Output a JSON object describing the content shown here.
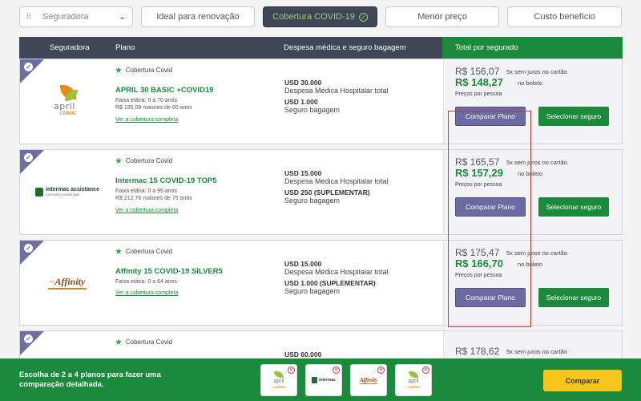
{
  "filters": {
    "insurer_select": {
      "placeholder": "Seguradora",
      "icon": "sliders-icon"
    },
    "buttons": [
      {
        "label": "Ideal para renovação",
        "active": false
      },
      {
        "label": "Cobertura COVID-19",
        "active": true
      },
      {
        "label": "Menor preço",
        "active": false
      },
      {
        "label": "Custo benefício",
        "active": false
      }
    ]
  },
  "table_header": {
    "insurer": "Seguradora",
    "plan": "Plano",
    "expenses": "Despesa médica e seguro bagagem",
    "total": "Total por segurado"
  },
  "plans": [
    {
      "insurer_logo": "April Corris",
      "logo_text": "april",
      "logo_subtext": "CORRIS",
      "covid_tag": "Cobertura Covid",
      "name": "APRIL 30 BASIC +COVID19",
      "faixa": "Faixa etária: 0 a 70 anos",
      "older_price": "R$ 195,09 maiores de 60 anos",
      "link": "Ver a cobertura completa",
      "medical_amount": "USD 30.000",
      "medical_label": "Despesa Médica Hospitalar total",
      "baggage_amount": "USD 1.000",
      "baggage_label": "Seguro bagagem",
      "price_card": "R$ 156,07",
      "price_card_note": "5x sem juros no cartão",
      "price_boleto": "R$ 148,27",
      "price_boleto_note": "no boleto",
      "price_note": "Preços por pessoa",
      "compare_label": "Comparar Plano",
      "select_label": "Selecionar seguro"
    },
    {
      "insurer_logo": "Intermac Assistance",
      "logo_text": "intermac assistance",
      "logo_subtext": "A SEGURO VIAGEM MAIS",
      "covid_tag": "Cobertura Covid",
      "name": "Intermac 15 COVID-19 TOP5",
      "faixa": "Faixa etária: 0 a 95 anos",
      "older_price": "R$ 212,76 maiores de 75 anos",
      "link": "Ver a cobertura completa",
      "medical_amount": "USD 15.000",
      "medical_label": "Despesa Médica Hospitalar total",
      "baggage_amount": "USD 250 (SUPLEMENTAR)",
      "baggage_label": "Seguro bagagem",
      "price_card": "R$ 165,57",
      "price_card_note": "5x sem juros no cartão",
      "price_boleto": "R$ 157,29",
      "price_boleto_note": "no boleto",
      "price_note": "Preços por pessoa",
      "compare_label": "Comparar Plano",
      "select_label": "Selecionar seguro"
    },
    {
      "insurer_logo": "Affinity",
      "logo_text": "Affinity",
      "covid_tag": "Cobertura Covid",
      "name": "Affinity 15 COVID-19 SILVER5",
      "faixa": "Faixa etária: 0 a 64 anos",
      "link": "Ver a cobertura completa",
      "medical_amount": "USD 15.000",
      "medical_label": "Despesa Médica Hospitalar total",
      "baggage_amount": "USD 1.000 (SUPLEMENTAR)",
      "baggage_label": "Seguro bagagem",
      "price_card": "R$ 175,47",
      "price_card_note": "5x sem juros no cartão",
      "price_boleto": "R$ 166,70",
      "price_boleto_note": "no boleto",
      "price_note": "Preços por pessoa",
      "compare_label": "Comparar Plano",
      "select_label": "Selecionar seguro"
    },
    {
      "covid_tag": "Cobertura Covid",
      "medical_amount": "USD 60.000",
      "price_card": "R$ 178,62",
      "price_card_note": "5x sem juros no cartão"
    }
  ],
  "compare_bar": {
    "text": "Escolha de 2 a 4 planos para fazer uma comparação detalhada.",
    "thumbnails": [
      "april",
      "intermac",
      "Affinity",
      "april"
    ],
    "button": "Comparar"
  },
  "colors": {
    "header_dark": "#3f4656",
    "green": "#1b8a3c",
    "purple": "#6b6aa2",
    "yellow": "#f7c61b",
    "highlight_red": "#c9352e"
  }
}
